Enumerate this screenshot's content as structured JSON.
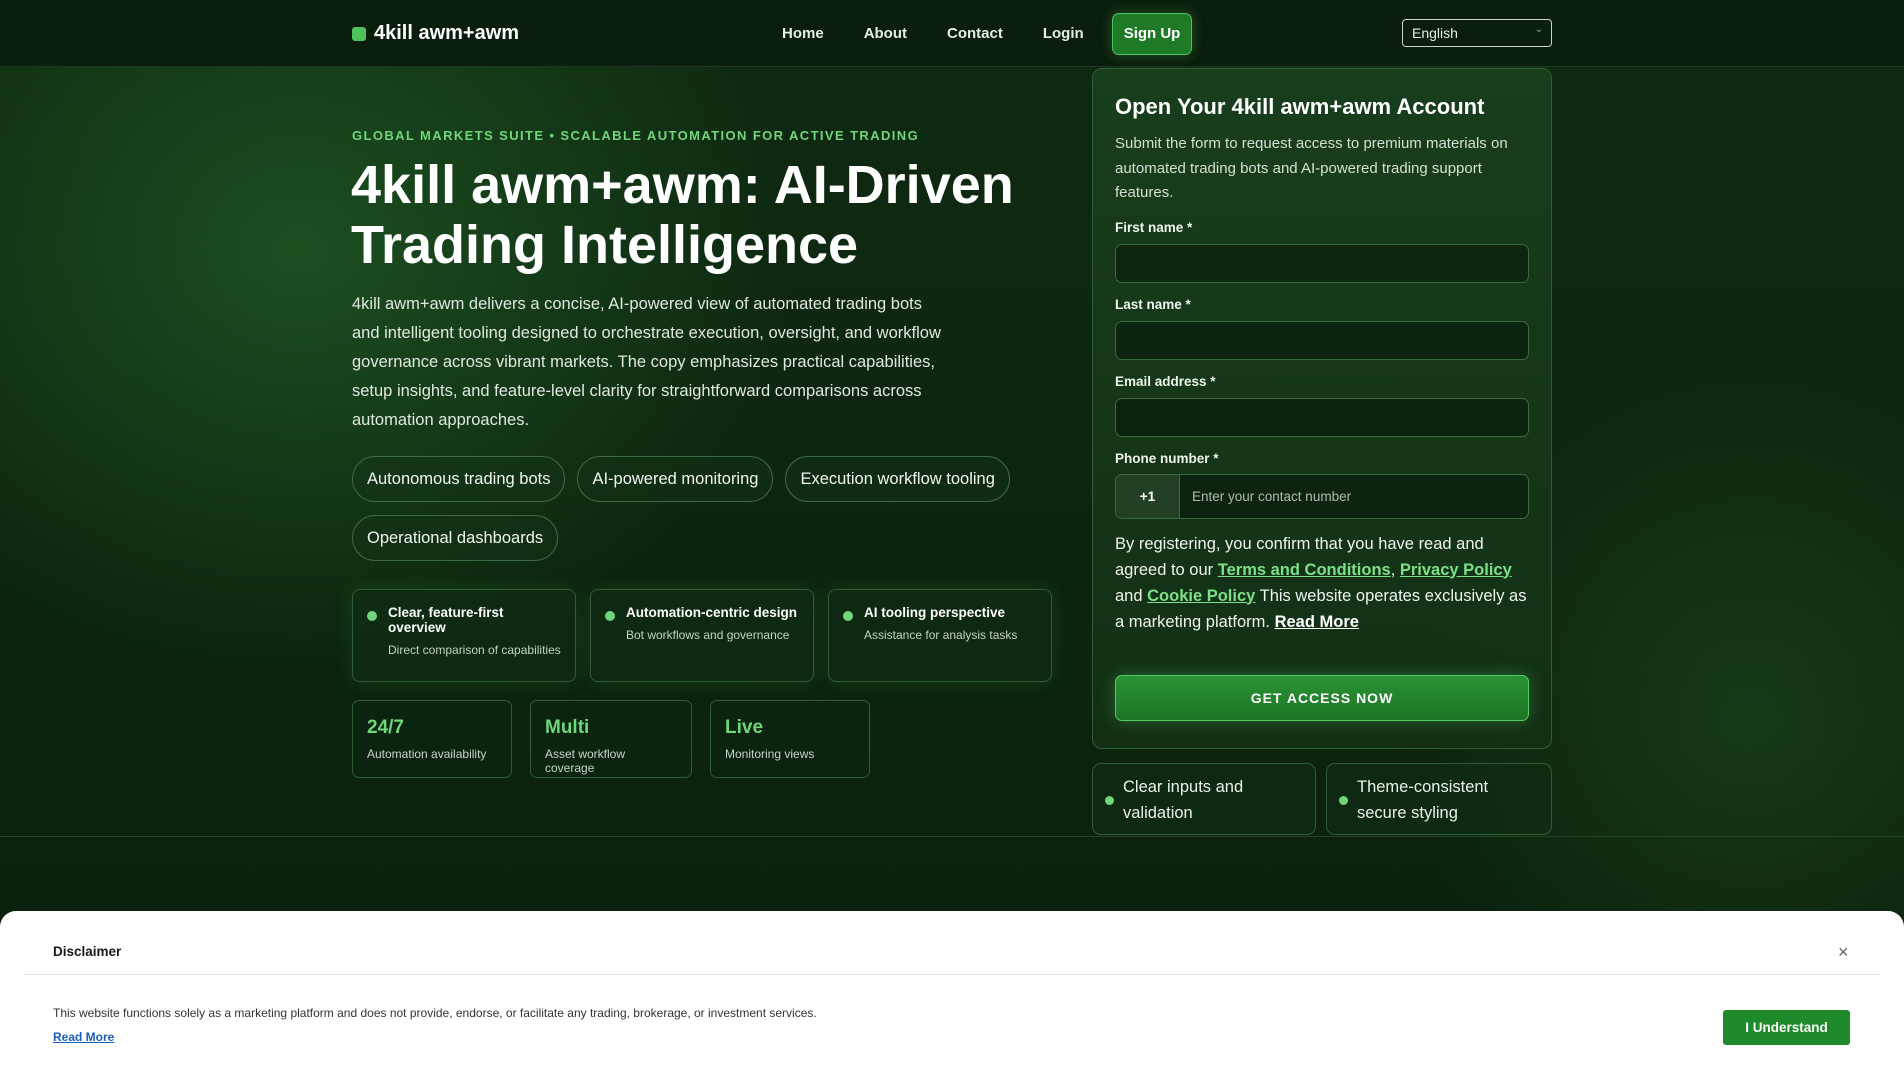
{
  "header": {
    "logo_text": "4kill awm+awm",
    "nav": [
      "Home",
      "About",
      "Contact",
      "Login"
    ],
    "signup": "Sign Up",
    "language": "English"
  },
  "hero": {
    "eyebrow": "GLOBAL MARKETS SUITE • SCALABLE AUTOMATION FOR ACTIVE TRADING",
    "title": "4kill awm+awm: AI-Driven Trading Intelligence",
    "description": "4kill awm+awm delivers a concise, AI-powered view of automated trading bots and intelligent tooling designed to orchestrate execution, oversight, and workflow governance across vibrant markets. The copy emphasizes practical capabilities, setup insights, and feature-level clarity for straightforward comparisons across automation approaches.",
    "pills": [
      "Autonomous trading bots",
      "AI-powered monitoring",
      "Execution workflow tooling",
      "Operational dashboards"
    ],
    "features": [
      {
        "title": "Clear, feature-first overview",
        "subtitle": "Direct comparison of capabilities"
      },
      {
        "title": "Automation-centric design",
        "subtitle": "Bot workflows and governance"
      },
      {
        "title": "AI tooling perspective",
        "subtitle": "Assistance for analysis tasks"
      }
    ],
    "stats": [
      {
        "value": "24/7",
        "label": "Automation availability"
      },
      {
        "value": "Multi",
        "label": "Asset workflow coverage"
      },
      {
        "value": "Live",
        "label": "Monitoring views"
      }
    ]
  },
  "form": {
    "title": "Open Your 4kill awm+awm Account",
    "subtitle": "Submit the form to request access to premium materials on automated trading bots and AI-powered trading support features.",
    "first_name_label": "First name *",
    "last_name_label": "Last name *",
    "email_label": "Email address *",
    "phone_label": "Phone number *",
    "phone_code": "+1",
    "phone_placeholder": "Enter your contact number",
    "terms_prefix": "By registering, you confirm that you have read and agreed to our ",
    "terms_link": "Terms and Conditions",
    "comma": ", ",
    "privacy_link": "Privacy Policy",
    "and": " and ",
    "cookie_link": "Cookie Policy",
    "terms_suffix": " This website operates exclusively as a marketing platform. ",
    "read_more": "Read More",
    "cta": "GET ACCESS NOW",
    "badges": [
      "Clear inputs and validation",
      "Theme-consistent secure styling"
    ]
  },
  "disclaimer": {
    "title": "Disclaimer",
    "text": "This website functions solely as a marketing platform and does not provide, endorse, or facilitate any trading, brokerage, or investment services.",
    "read_more": "Read More",
    "button": "I Understand",
    "close": "×"
  }
}
